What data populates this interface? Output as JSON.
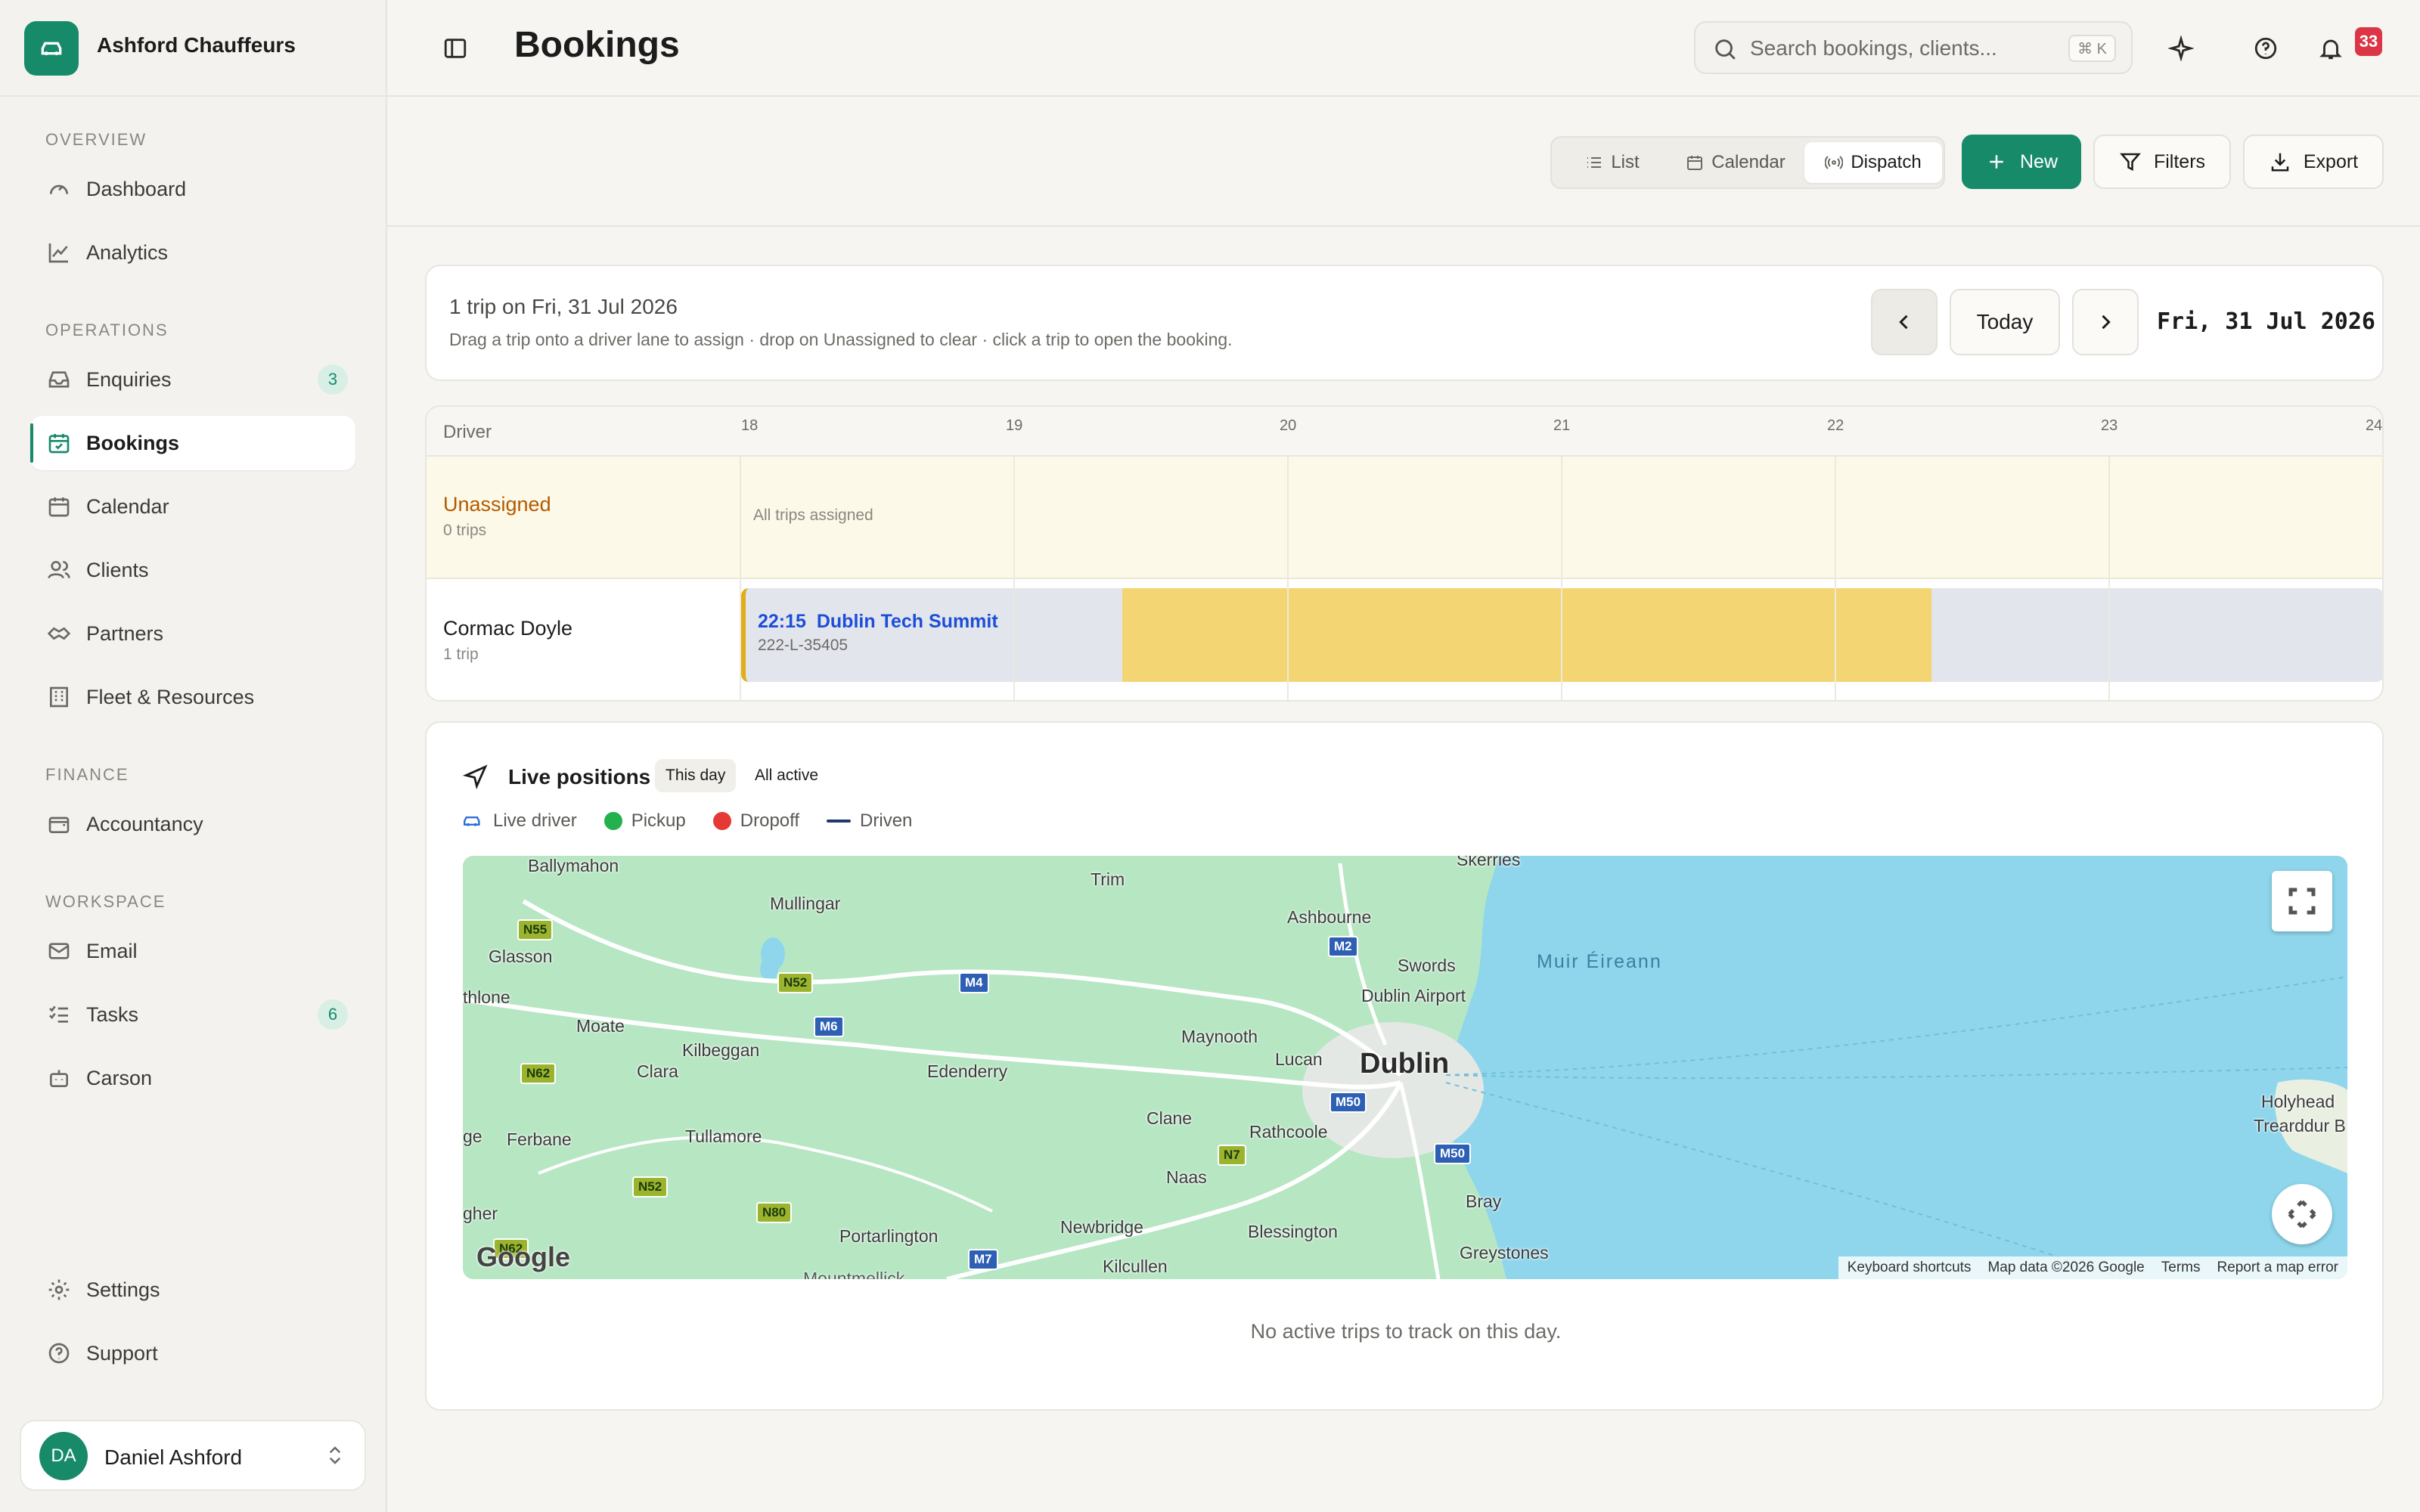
{
  "sidebar": {
    "brand": "Ashford Chauffeurs",
    "sections": {
      "overview": "OVERVIEW",
      "operations": "OPERATIONS",
      "finance": "FINANCE",
      "workspace": "WORKSPACE"
    },
    "items": {
      "dashboard": "Dashboard",
      "analytics": "Analytics",
      "enquiries": "Enquiries",
      "enquiries_badge": "3",
      "bookings": "Bookings",
      "calendar": "Calendar",
      "clients": "Clients",
      "partners": "Partners",
      "fleet": "Fleet & Resources",
      "accountancy": "Accountancy",
      "email": "Email",
      "tasks": "Tasks",
      "tasks_badge": "6",
      "carson": "Carson",
      "settings": "Settings",
      "support": "Support"
    },
    "user": {
      "initials": "DA",
      "name": "Daniel Ashford"
    },
    "active_item": "bookings",
    "accent_color": "#178a6a"
  },
  "header": {
    "title": "Bookings",
    "search_placeholder": "Search bookings, clients...",
    "search_shortcut": "⌘ K",
    "notification_count": "33"
  },
  "toolbar": {
    "views": {
      "list": "List",
      "calendar": "Calendar",
      "dispatch": "Dispatch"
    },
    "active_view": "dispatch",
    "new_label": "New",
    "filters_label": "Filters",
    "export_label": "Export"
  },
  "dispatch": {
    "summary": "1 trip on Fri, 31 Jul 2026",
    "instructions": "Drag a trip onto a driver lane to assign · drop on Unassigned to clear · click a trip to open the booking.",
    "today_label": "Today",
    "date": "Fri, 31 Jul 2026",
    "driver_column": "Driver",
    "hours": [
      "18",
      "19",
      "20",
      "21",
      "22",
      "23",
      "24"
    ],
    "unassigned": {
      "name": "Unassigned",
      "count": "0 trips",
      "empty_text": "All trips assigned"
    },
    "drivers": [
      {
        "name": "Cormac Doyle",
        "count": "1 trip",
        "trip": {
          "time": "22:15",
          "title": "Dublin Tech Summit",
          "ref": "222-L-35405"
        }
      }
    ]
  },
  "live": {
    "title": "Live positions",
    "filters": {
      "this_day": "This day",
      "all_active": "All active"
    },
    "active_filter": "this_day",
    "legend": {
      "driver": "Live driver",
      "pickup": "Pickup",
      "dropoff": "Dropoff",
      "driven": "Driven"
    },
    "legend_colors": {
      "pickup": "#22b14c",
      "dropoff": "#e53935",
      "driven": "#1e3a6d",
      "driver": "#2d6fd6"
    },
    "map": {
      "labels": {
        "skerries": "Skerries",
        "ballymahon": "Ballymahon",
        "mullingar": "Mullingar",
        "trim": "Trim",
        "ashbourne": "Ashbourne",
        "glasson": "Glasson",
        "swords": "Swords",
        "muir": "Muir Éireann",
        "athlone": "thlone",
        "moate": "Moate",
        "kilbeggan": "Kilbeggan",
        "dublin_airport": "Dublin Airport",
        "maynooth": "Maynooth",
        "clara": "Clara",
        "edenderry": "Edenderry",
        "lucan": "Lucan",
        "dublin": "Dublin",
        "holyhead": "Holyhead",
        "trearddur": "Trearddur B",
        "clane": "Clane",
        "ge": "ge",
        "ferbane": "Ferbane",
        "tullamore": "Tullamore",
        "rathcoole": "Rathcoole",
        "naas": "Naas",
        "bray": "Bray",
        "gher": "gher",
        "newbridge": "Newbridge",
        "blessington": "Blessington",
        "portarlington": "Portarlington",
        "greystones": "Greystones",
        "kilcullen": "Kilcullen",
        "mountmellick": "Mountmellick"
      },
      "roads": {
        "n55": "N55",
        "m2": "M2",
        "n52a": "N52",
        "m4": "M4",
        "m6": "M6",
        "n62a": "N62",
        "m50a": "M50",
        "m50b": "M50",
        "n7": "N7",
        "n52b": "N52",
        "n80": "N80",
        "n62b": "N62",
        "m7": "M7"
      },
      "provider": "Google",
      "attribution": {
        "shortcuts": "Keyboard shortcuts",
        "data": "Map data ©2026 Google",
        "terms": "Terms",
        "report": "Report a map error"
      }
    },
    "empty_text": "No active trips to track on this day."
  }
}
